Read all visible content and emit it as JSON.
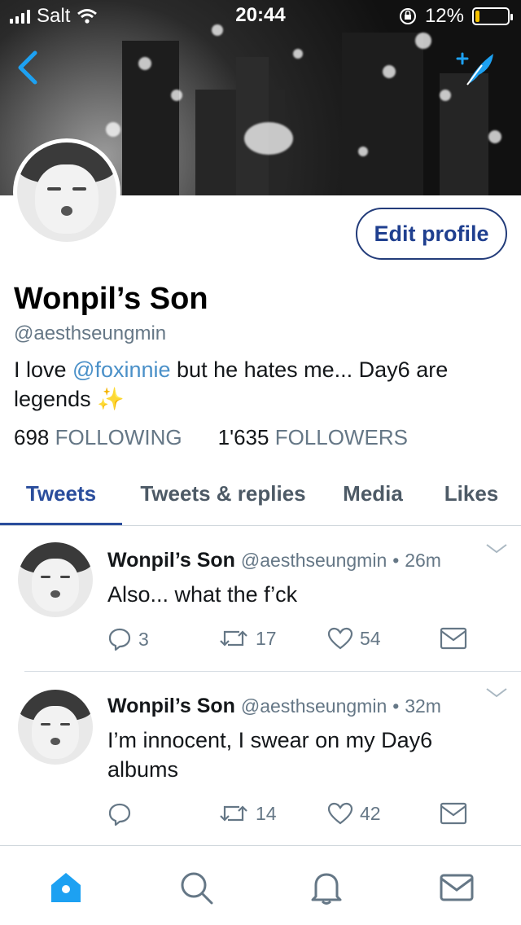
{
  "status_bar": {
    "carrier": "Salt",
    "time": "20:44",
    "battery_text": "12%",
    "battery_level": 0.12
  },
  "colors": {
    "accent": "#2a4d9c",
    "link": "#4a90c8",
    "icon_blue": "#1da1f2",
    "muted": "#657786"
  },
  "header": {
    "back_icon": "chevron-left-icon",
    "compose_icon": "feather-quill-icon"
  },
  "profile": {
    "edit_button": "Edit profile",
    "name": "Wonpil’s Son",
    "handle": "@aesthseungmin",
    "bio_prefix": "I love ",
    "bio_mention": "@foxinnie",
    "bio_suffix": " but he hates me... Day6 are legends ",
    "bio_emoji": "✨",
    "following_count": "698",
    "following_label": "FOLLOWING",
    "followers_count": "1'635",
    "followers_label": "FOLLOWERS"
  },
  "tabs": [
    {
      "label": "Tweets",
      "active": true
    },
    {
      "label": "Tweets & replies",
      "active": false
    },
    {
      "label": "Media",
      "active": false
    },
    {
      "label": "Likes",
      "active": false
    }
  ],
  "tweets": [
    {
      "name": "Wonpil’s Son",
      "handle": "@aesthseungmin",
      "sep": "•",
      "time": "26m",
      "text": "Also... what the f’ck",
      "replies": "3",
      "retweets": "17",
      "likes": "54"
    },
    {
      "name": "Wonpil’s Son",
      "handle": "@aesthseungmin",
      "sep": "•",
      "time": "32m",
      "text": "I’m innocent, I swear on my Day6 albums",
      "replies": "",
      "retweets": "14",
      "likes": "42"
    }
  ],
  "tabbar": {
    "icons": [
      "home-icon",
      "search-icon",
      "notifications-bell-icon",
      "messages-envelope-icon"
    ]
  }
}
